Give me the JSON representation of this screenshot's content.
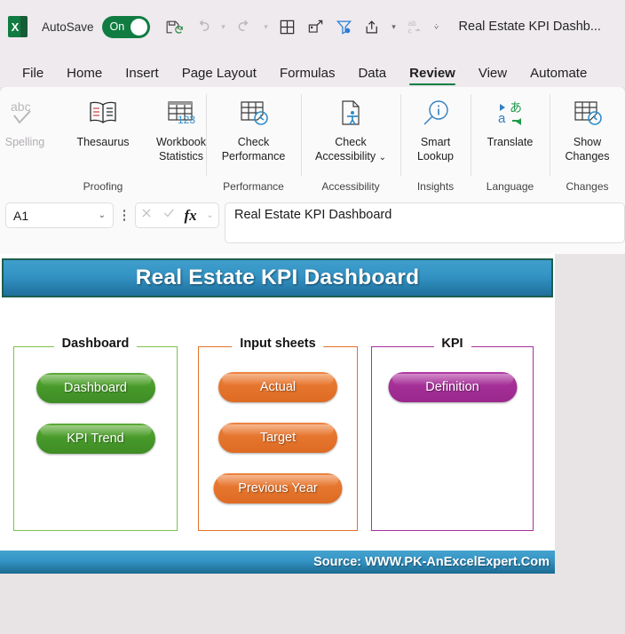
{
  "titlebar": {
    "app_icon": "excel-logo",
    "autosave_label": "AutoSave",
    "autosave_state": "On",
    "icons": [
      {
        "name": "save-icon",
        "glyph": "save"
      },
      {
        "name": "undo-icon",
        "glyph": "undo"
      },
      {
        "name": "redo-icon",
        "glyph": "redo"
      },
      {
        "name": "table-icon",
        "glyph": "table"
      },
      {
        "name": "touch-draw-icon",
        "glyph": "draw"
      },
      {
        "name": "filter-icon",
        "glyph": "filter"
      },
      {
        "name": "share-icon",
        "glyph": "share"
      },
      {
        "name": "spelling-abc-icon",
        "glyph": "abc"
      },
      {
        "name": "customize-toolbar-icon",
        "glyph": "chevron"
      }
    ],
    "document_title": "Real Estate KPI Dashb..."
  },
  "ribbon_tabs": [
    {
      "label": "File",
      "active": false
    },
    {
      "label": "Home",
      "active": false
    },
    {
      "label": "Insert",
      "active": false
    },
    {
      "label": "Page Layout",
      "active": false
    },
    {
      "label": "Formulas",
      "active": false
    },
    {
      "label": "Data",
      "active": false
    },
    {
      "label": "Review",
      "active": true
    },
    {
      "label": "View",
      "active": false
    },
    {
      "label": "Automate",
      "active": false
    }
  ],
  "ribbon_groups": [
    {
      "name": "Proofing",
      "items": [
        {
          "label": "Spelling",
          "icon": "spelling-check-icon",
          "disabled": true
        },
        {
          "label": "Thesaurus",
          "icon": "thesaurus-book-icon",
          "disabled": false
        },
        {
          "label": "Workbook Statistics",
          "icon": "workbook-statistics-icon",
          "disabled": false
        }
      ]
    },
    {
      "name": "Performance",
      "items": [
        {
          "label": "Check Performance",
          "icon": "check-performance-icon",
          "disabled": false
        }
      ]
    },
    {
      "name": "Accessibility",
      "items": [
        {
          "label": "Check Accessibility",
          "icon": "check-accessibility-icon",
          "disabled": false,
          "dropdown": true
        }
      ]
    },
    {
      "name": "Insights",
      "items": [
        {
          "label": "Smart Lookup",
          "icon": "smart-lookup-icon",
          "disabled": false
        }
      ]
    },
    {
      "name": "Language",
      "items": [
        {
          "label": "Translate",
          "icon": "translate-icon",
          "disabled": false
        }
      ]
    },
    {
      "name": "Changes",
      "items": [
        {
          "label": "Show Changes",
          "icon": "show-changes-icon",
          "disabled": false
        }
      ]
    }
  ],
  "formula_bar": {
    "name_box_value": "A1",
    "cancel_icon": "cancel-x-icon",
    "enter_icon": "enter-check-icon",
    "fx_label": "fx",
    "formula_value": "Real Estate KPI Dashboard"
  },
  "sheet": {
    "banner_title": "Real Estate KPI Dashboard",
    "banner_color": "#3393c4",
    "banner_border_color": "#1d5e4f",
    "panels": [
      {
        "title": "Dashboard",
        "accent": "#7ec24a",
        "buttons": [
          {
            "label": "Dashboard",
            "style": "green"
          },
          {
            "label": "KPI Trend",
            "style": "green"
          }
        ]
      },
      {
        "title": "Input sheets",
        "accent": "#e4722a",
        "buttons": [
          {
            "label": "Actual",
            "style": "orange"
          },
          {
            "label": "Target",
            "style": "orange"
          },
          {
            "label": "Previous Year",
            "style": "orange"
          }
        ]
      },
      {
        "title": "KPI",
        "accent": "#a8309c",
        "buttons": [
          {
            "label": "Definition",
            "style": "purple"
          }
        ]
      }
    ],
    "footer_text": "Source: WWW.PK-AnExcelExpert.Com"
  }
}
